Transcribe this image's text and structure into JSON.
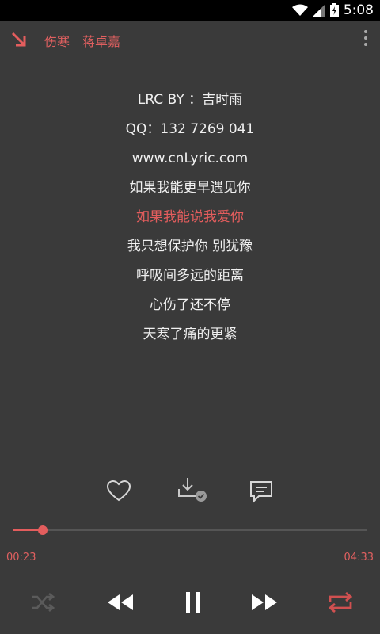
{
  "status_bar": {
    "time": "5:08"
  },
  "header": {
    "song_title": "伤寒",
    "artist": "蒋卓嘉"
  },
  "lyrics": [
    {
      "text": "LRC BY ：吉时雨"
    },
    {
      "text": "QQ：132 7269 041"
    },
    {
      "text": "www.cnLyric.com"
    },
    {
      "text": "如果我能更早遇见你"
    },
    {
      "text": "如果我能说我爱你"
    },
    {
      "text": "我只想保护你 别犹豫"
    },
    {
      "text": "呼吸间多远的距离"
    },
    {
      "text": "心伤了还不停"
    },
    {
      "text": "天寒了痛的更紧"
    }
  ],
  "active_lyric_index": 4,
  "playback": {
    "current_time": "00:23",
    "total_time": "04:33",
    "progress_fraction": 0.084
  },
  "colors": {
    "accent": "#e35d5d",
    "background": "#3a3a3a",
    "text": "#f0f0f0",
    "icon_gray": "#bdbdbd"
  },
  "icons": {
    "minimize": "arrow-down-right-icon",
    "menu": "more-vert-icon",
    "favorite": "heart-icon",
    "download": "download-icon",
    "comment": "comment-icon",
    "shuffle": "shuffle-icon",
    "previous": "rewind-icon",
    "pause": "pause-icon",
    "next": "fast-forward-icon",
    "repeat": "repeat-icon"
  }
}
